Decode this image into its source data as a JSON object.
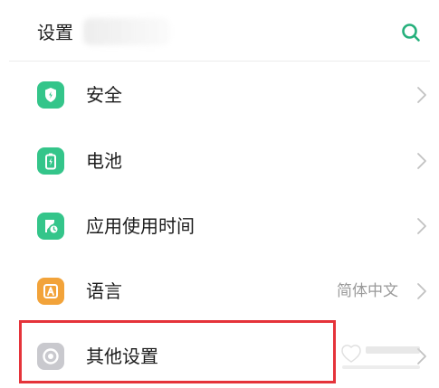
{
  "header": {
    "title": "设置"
  },
  "icons": {
    "search": "search-icon",
    "chevron": "chevron-right-icon"
  },
  "colors": {
    "accent": "#26b07c",
    "security_icon": "#34c58a",
    "battery_icon": "#34c58a",
    "screen_time_icon": "#34c58a",
    "language_icon": "#f2a33a",
    "other_settings_icon": "#c9c9ce",
    "highlight": "#e5333a",
    "secondary_text": "#9a9a9a"
  },
  "settings": {
    "items": [
      {
        "label": "安全",
        "icon": "shield-icon",
        "value": ""
      },
      {
        "label": "电池",
        "icon": "battery-icon",
        "value": ""
      },
      {
        "label": "应用使用时间",
        "icon": "hourglass-clock-icon",
        "value": ""
      },
      {
        "label": "语言",
        "icon": "language-a-icon",
        "value": "简体中文"
      },
      {
        "label": "其他设置",
        "icon": "other-settings-icon",
        "value": ""
      }
    ]
  }
}
